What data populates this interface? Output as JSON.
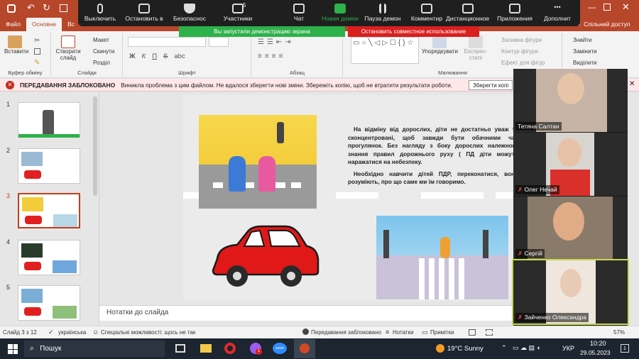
{
  "ribbon": {
    "tabs": [
      "Файл",
      "Основне",
      "Вс"
    ],
    "share_label": "Спільний доступ",
    "groups": {
      "clipboard": {
        "label": "Буфер обміну",
        "paste": "Вставити"
      },
      "slides": {
        "label": "Слайди",
        "new_slide": "Створити слайд",
        "layout": "Макет",
        "reset": "Скинути",
        "section": "Розділ"
      },
      "font": {
        "label": "Шрифт",
        "bold": "Ж",
        "italic": "К",
        "underline": "П",
        "strike": "S",
        "abc": "abc"
      },
      "paragraph": {
        "label": "Абзац"
      },
      "drawing": {
        "label": "Малювання",
        "arrange": "Упорядкувати",
        "express_styles": "Експрес-стилі",
        "shape_fill": "Заливка фігури",
        "shape_outline": "Контур фігури",
        "shape_effects": "Ефект для фігур"
      },
      "editing": {
        "find": "Знайти",
        "replace": "Замінити",
        "select": "Виділити"
      }
    }
  },
  "zoom": {
    "items": [
      {
        "label": "Выключить",
        "icon": "microphone-icon"
      },
      {
        "label": "Остановить в",
        "icon": "video-camera-icon"
      },
      {
        "label": "Безопаснос",
        "icon": "shield-icon"
      },
      {
        "label": "Участники",
        "icon": "participants-icon",
        "count": "5"
      },
      {
        "label": "Чат",
        "icon": "chat-icon"
      },
      {
        "label": "Новая демон",
        "icon": "share-screen-icon"
      },
      {
        "label": "Пауза демон",
        "icon": "pause-icon"
      },
      {
        "label": "Комментир",
        "icon": "annotate-pen-icon"
      },
      {
        "label": "Дистанционное у",
        "icon": "remote-control-icon"
      },
      {
        "label": "Приложения",
        "icon": "apps-icon"
      },
      {
        "label": "Дополнит",
        "icon": "more-dots-icon"
      }
    ],
    "share_banner": "Вы запустили демонстрацию экрана",
    "stop_banner": "Остановить совместное использование"
  },
  "error_bar": {
    "title": "ПЕРЕДАВАННЯ ЗАБЛОКОВАНО",
    "message": "Виникла проблема з цим файлом. Не вдалося зберегти нові зміни. Збережіть копію, щоб не втратити результати роботи.",
    "button": "Зберегти копі"
  },
  "slides": {
    "numbers": [
      "1",
      "2",
      "3",
      "4",
      "5"
    ],
    "selected_index": 3
  },
  "slide": {
    "paragraph1": "На відміну від дорослих, діти не достатньо уваж та сконцентровані, щоб завжди бути обачними час прогулянок. Без нагляду з боку дорослих належного знання правил дорожнього руху ( ПД діти можуть наражатися на небезпеку.",
    "paragraph2": "Необхідно навчити дітей ПДР, переконатися, вони розуміють, про що саме ми їм говоримо."
  },
  "notes": {
    "placeholder": "Нотатки до слайда"
  },
  "status": {
    "slide_count": "Слайд 3 з 12",
    "language": "українська",
    "accessibility": "Спеціальні можливості: щось не так",
    "upload_blocked": "Передавання заблоковано",
    "notes_button": "Нотатки",
    "comments_button": "Примітки",
    "zoom_level": "57%"
  },
  "participants": [
    {
      "name": "Тетяна Салтан",
      "muted": false
    },
    {
      "name": "Олег Нечай",
      "muted": true
    },
    {
      "name": "Сергій",
      "muted": true
    },
    {
      "name": "Зайченко Олександра",
      "muted": true
    }
  ],
  "taskbar": {
    "search": "Пошук",
    "weather": "19°C Sunny",
    "language": "УКР",
    "time": "10:20",
    "date": "29.05.2023",
    "zoom_app_label": "zoom",
    "notification_count": "1"
  },
  "colors": {
    "ppt_accent": "#b7472a",
    "zoom_green": "#2db14a",
    "zoom_red": "#d9201f",
    "error_red": "#c42b1c"
  }
}
